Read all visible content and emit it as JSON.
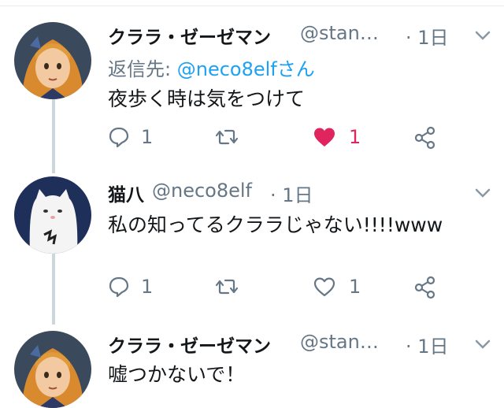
{
  "colors": {
    "accent": "#1da1f2",
    "secondary": "#657786",
    "like": "#e0245e",
    "thread_line": "#ccd6dd"
  },
  "tweets": [
    {
      "author_name": "クララ・ゼーゼマン",
      "author_handle": "@stan…",
      "time": "· 1日",
      "reply_prefix": "返信先:",
      "reply_mention": "@neco8elfさん",
      "text": "夜歩く時は気をつけて",
      "replies": "1",
      "retweets": "",
      "likes": "1",
      "liked": true
    },
    {
      "author_name": "猫八",
      "author_handle": "@neco8elf",
      "time": "· 1日",
      "text": "私の知ってるクララじゃない!!!!www",
      "replies": "1",
      "retweets": "",
      "likes": "1",
      "liked": false
    },
    {
      "author_name": "クララ・ゼーゼマン",
      "author_handle": "@stan…",
      "time": "· 1日",
      "text": "嘘つかないで！"
    }
  ],
  "icons": [
    "avatar-clara",
    "avatar-cat",
    "chevron-down-icon",
    "reply-icon",
    "retweet-icon",
    "heart-icon",
    "share-icon"
  ]
}
